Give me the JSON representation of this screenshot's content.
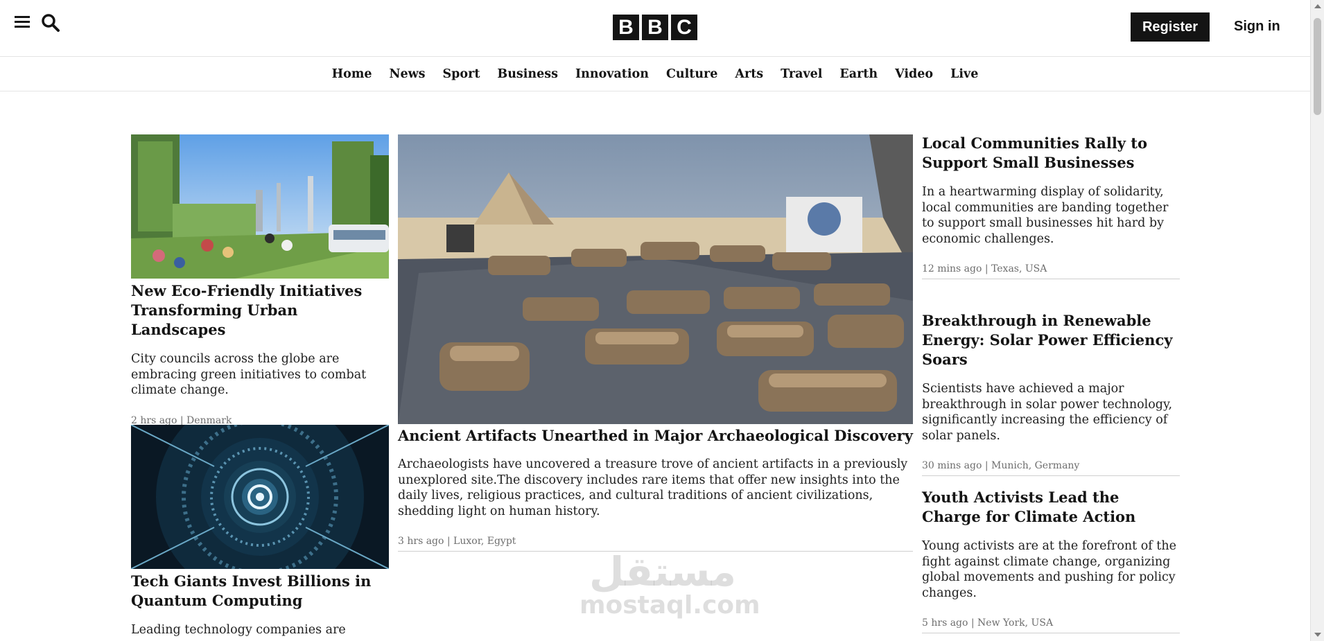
{
  "header": {
    "logo_letters": [
      "B",
      "B",
      "C"
    ],
    "register_label": "Register",
    "signin_label": "Sign in"
  },
  "nav": {
    "items": [
      "Home",
      "News",
      "Sport",
      "Business",
      "Innovation",
      "Culture",
      "Arts",
      "Travel",
      "Earth",
      "Video",
      "Live"
    ]
  },
  "articles": {
    "eco": {
      "title": "New Eco-Friendly Initiatives Transforming Urban Landscapes",
      "summary": "City councils across the globe are embracing green initiatives to combat climate change.",
      "meta": "2 hrs ago | Denmark"
    },
    "quantum": {
      "title": "Tech Giants Invest Billions in Quantum Computing",
      "summary": "Leading technology companies are"
    },
    "artifacts": {
      "title": "Ancient Artifacts Unearthed in Major Archaeological Discovery",
      "summary": "Archaeologists have uncovered a treasure trove of ancient artifacts in a previously unexplored site.The discovery includes rare items that offer new insights into the daily lives, religious practices, and cultural traditions of ancient civilizations, shedding light on human history.",
      "meta": "3 hrs ago | Luxor, Egypt"
    },
    "communities": {
      "title": "Local Communities Rally to Support Small Businesses",
      "summary": "In a heartwarming display of solidarity, local communities are banding together to support small businesses hit hard by economic challenges.",
      "meta": "12 mins ago | Texas, USA"
    },
    "solar": {
      "title": "Breakthrough in Renewable Energy: Solar Power Efficiency Soars",
      "summary": "Scientists have achieved a major breakthrough in solar power technology, significantly increasing the efficiency of solar panels.",
      "meta": "30 mins ago | Munich, Germany"
    },
    "climate": {
      "title": "Youth Activists Lead the Charge for Climate Action",
      "summary": "Young activists are at the forefront of the fight against climate change, organizing global movements and pushing for policy changes.",
      "meta": "5 hrs ago | New York, USA"
    }
  },
  "watermark": {
    "arabic": "مستقل",
    "latin": "mostaql.com"
  },
  "icons": {
    "menu": "hamburger-menu-icon",
    "search": "search-icon"
  }
}
